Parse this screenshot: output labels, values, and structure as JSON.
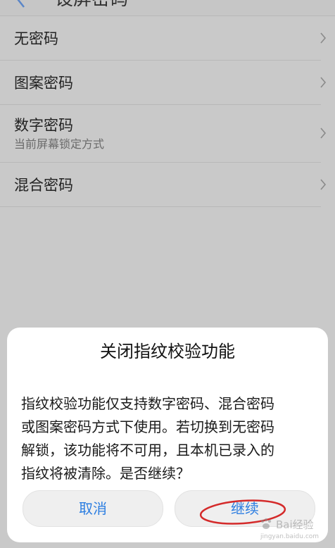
{
  "header": {
    "title": "设屏密码",
    "back_icon": "back-arrow-icon"
  },
  "lock_options": [
    {
      "label": "无密码"
    },
    {
      "label": "图案密码"
    },
    {
      "label": "数字密码",
      "subtitle": "当前屏幕锁定方式"
    },
    {
      "label": "混合密码"
    }
  ],
  "dialog": {
    "title": "关闭指纹校验功能",
    "message": "指纹校验功能仅支持数字密码、混合密码\n或图案密码方式下使用。若切换到无密码\n解锁，该功能将不可用，且本机已录入的\n指纹将被清除。是否继续？",
    "cancel_label": "取消",
    "continue_label": "继续"
  },
  "watermark": {
    "main": "Bai经验",
    "sub": "jingyan.baidu.com"
  },
  "colors": {
    "accent": "#2b7de1",
    "overlay_background": "#c9c9c9",
    "annotation_red": "#d42a2a"
  }
}
